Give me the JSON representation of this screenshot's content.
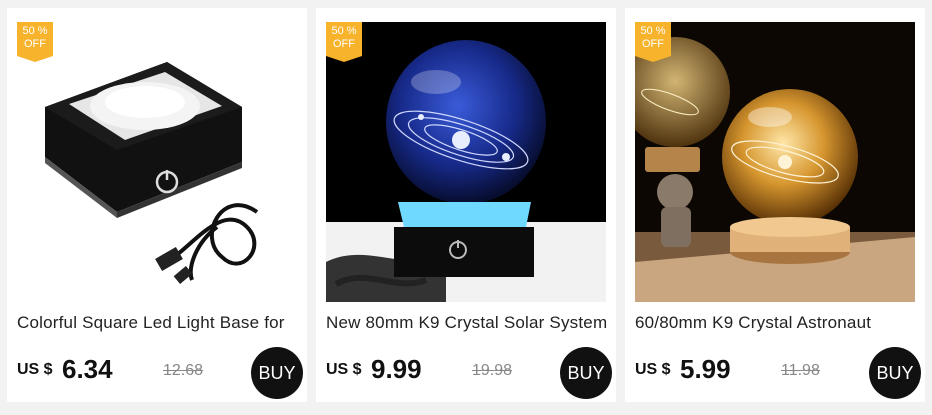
{
  "products": [
    {
      "badge": "50 % OFF",
      "title": "Colorful Square Led Light Base for",
      "currency_prefix": "US $",
      "price": "6.34",
      "old_price": "12.68",
      "buy_label": "BUY",
      "image_icon": "led-light-base-image"
    },
    {
      "badge": "50 % OFF",
      "title": "New 80mm K9 Crystal Solar System",
      "currency_prefix": "US $",
      "price": "9.99",
      "old_price": "19.98",
      "buy_label": "BUY",
      "image_icon": "crystal-ball-blue-image"
    },
    {
      "badge": "50 % OFF",
      "title": "60/80mm K9 Crystal Astronaut",
      "currency_prefix": "US $",
      "price": "5.99",
      "old_price": "11.98",
      "buy_label": "BUY",
      "image_icon": "crystal-ball-warm-image"
    }
  ],
  "colors": {
    "badge": "#f7b32b",
    "buy_button": "#111111",
    "old_price": "#888888"
  }
}
